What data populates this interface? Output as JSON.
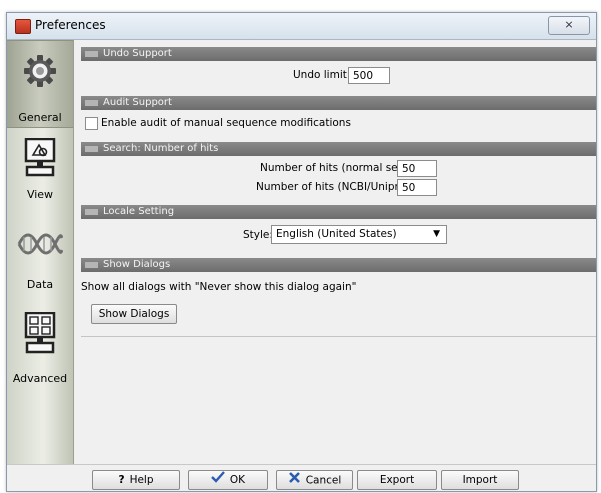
{
  "window": {
    "title": "Preferences",
    "close_glyph": "⨯"
  },
  "sidebar": {
    "items": [
      {
        "label": "General",
        "icon": "gear-icon",
        "selected": true
      },
      {
        "label": "View",
        "icon": "monitor-icon",
        "selected": false
      },
      {
        "label": "Data",
        "icon": "dna-icon",
        "selected": false
      },
      {
        "label": "Advanced",
        "icon": "advanced-monitor-icon",
        "selected": false
      }
    ]
  },
  "sections": {
    "undo": {
      "title": "Undo Support",
      "limit_label": "Undo limit:",
      "limit_value": "500"
    },
    "audit": {
      "title": "Audit Support",
      "checkbox_label": "Enable audit of manual sequence modifications",
      "checked": false
    },
    "search": {
      "title": "Search: Number of hits",
      "normal_label": "Number of hits (normal search):",
      "normal_value": "50",
      "ncbi_label": "Number of hits (NCBI/Uniprot):",
      "ncbi_value": "50"
    },
    "locale": {
      "title": "Locale Setting",
      "style_label": "Style:",
      "style_value": "English (United States)"
    },
    "dialogs": {
      "title": "Show Dialogs",
      "description": "Show all dialogs with \"Never show this dialog again\"",
      "button_label": "Show Dialogs"
    }
  },
  "footer": {
    "help": "Help",
    "ok": "OK",
    "cancel": "Cancel",
    "export": "Export",
    "import": "Import"
  },
  "colors": {
    "section_header": "#777777",
    "ok_check": "#2a5db0",
    "cancel_x": "#2a5db0",
    "app_icon": "#c9402a"
  }
}
